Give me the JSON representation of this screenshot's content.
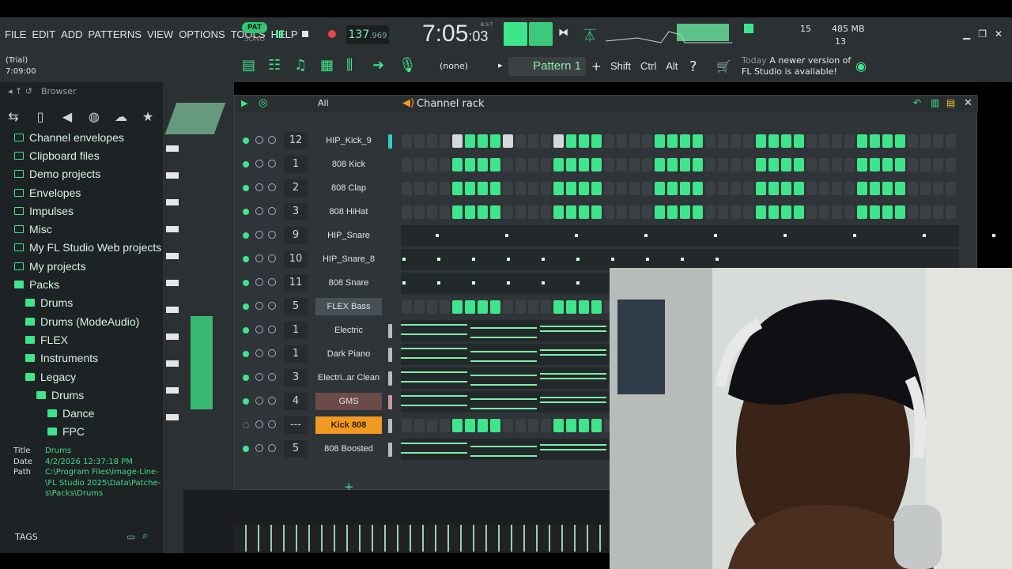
{
  "menu": [
    "FILE",
    "EDIT",
    "ADD",
    "PATTERNS",
    "VIEW",
    "OPTIONS",
    "TOOLS",
    "HELP"
  ],
  "mode": {
    "pat": "PAT",
    "song": "SONG"
  },
  "tempo": {
    "int": "137",
    "frac": ".969"
  },
  "time": {
    "main": "7:05",
    "small": ":03",
    "bst": "B:S:T"
  },
  "cpu": {
    "polyphony": "15",
    "memory": "485 MB",
    "voices": "13"
  },
  "trial": {
    "label": "(Trial)",
    "time": "7:09:00"
  },
  "pattern": {
    "none": "(none)",
    "name": "Pattern 1"
  },
  "modifiers": [
    "Shift",
    "Ctrl",
    "Alt"
  ],
  "news": {
    "today": "Today",
    "line1": "A newer version of",
    "line2": "FL Studio is available!"
  },
  "browser": {
    "title": "Browser",
    "items": [
      {
        "label": "Channel envelopes",
        "indent": 0,
        "full": false
      },
      {
        "label": "Clipboard files",
        "indent": 0,
        "full": false
      },
      {
        "label": "Demo projects",
        "indent": 0,
        "full": false
      },
      {
        "label": "Envelopes",
        "indent": 0,
        "full": false
      },
      {
        "label": "Impulses",
        "indent": 0,
        "full": false
      },
      {
        "label": "Misc",
        "indent": 0,
        "full": false
      },
      {
        "label": "My FL Studio Web projects",
        "indent": 0,
        "full": false
      },
      {
        "label": "My projects",
        "indent": 0,
        "full": false
      },
      {
        "label": "Packs",
        "indent": 0,
        "full": true
      },
      {
        "label": "Drums",
        "indent": 1,
        "full": true
      },
      {
        "label": "Drums (ModeAudio)",
        "indent": 1,
        "full": true
      },
      {
        "label": "FLEX",
        "indent": 1,
        "full": true
      },
      {
        "label": "Instruments",
        "indent": 1,
        "full": true
      },
      {
        "label": "Legacy",
        "indent": 1,
        "full": true
      },
      {
        "label": "Drums",
        "indent": 2,
        "full": true
      },
      {
        "label": "Dance",
        "indent": 3,
        "full": true
      },
      {
        "label": "FPC",
        "indent": 3,
        "full": true
      }
    ],
    "meta": {
      "title_label": "Title",
      "title": "Drums",
      "date_label": "Date",
      "date": "4/2/2026 12:37:18 PM",
      "path_label": "Path",
      "path1": "C:\\Program Files\\Image-Line-",
      "path2": "\\FL Studio 2025\\Data\\Patche-",
      "path3": "s\\Packs\\Drums"
    },
    "tags": "TAGS"
  },
  "channel_rack": {
    "title": "Channel rack",
    "filter": "All",
    "channels": [
      {
        "num": "12",
        "name": "HIP_Kick_9",
        "type": "steps",
        "style": "",
        "bar": "cyan"
      },
      {
        "num": "1",
        "name": "808 Kick",
        "type": "steps",
        "style": "",
        "bar": ""
      },
      {
        "num": "2",
        "name": "808 Clap",
        "type": "steps",
        "style": "",
        "bar": ""
      },
      {
        "num": "3",
        "name": "808 HiHat",
        "type": "steps",
        "style": "",
        "bar": ""
      },
      {
        "num": "9",
        "name": "HIP_Snare",
        "type": "dots",
        "style": "",
        "bar": ""
      },
      {
        "num": "10",
        "name": "HIP_Snare_8",
        "type": "dots",
        "style": "",
        "bar": ""
      },
      {
        "num": "11",
        "name": "808 Snare",
        "type": "dots",
        "style": "",
        "bar": ""
      },
      {
        "num": "5",
        "name": "FLEX Bass",
        "type": "steps",
        "style": "flex",
        "bar": ""
      },
      {
        "num": "1",
        "name": "Electric",
        "type": "roll",
        "style": "",
        "bar": "w"
      },
      {
        "num": "1",
        "name": "Dark Piano",
        "type": "roll",
        "style": "",
        "bar": "w"
      },
      {
        "num": "3",
        "name": "Electri..ar Clean",
        "type": "roll",
        "style": "",
        "bar": "w"
      },
      {
        "num": "4",
        "name": "GMS",
        "type": "roll",
        "style": "gms",
        "bar": "pink"
      },
      {
        "num": "---",
        "name": "Kick 808",
        "type": "steps",
        "style": "kick",
        "bar": "w"
      },
      {
        "num": "5",
        "name": "808 Boosted",
        "type": "roll",
        "style": "",
        "bar": "w"
      }
    ],
    "add_label": "+"
  },
  "colors": {
    "accent": "#3ee58a",
    "bg": "#2b3033"
  }
}
